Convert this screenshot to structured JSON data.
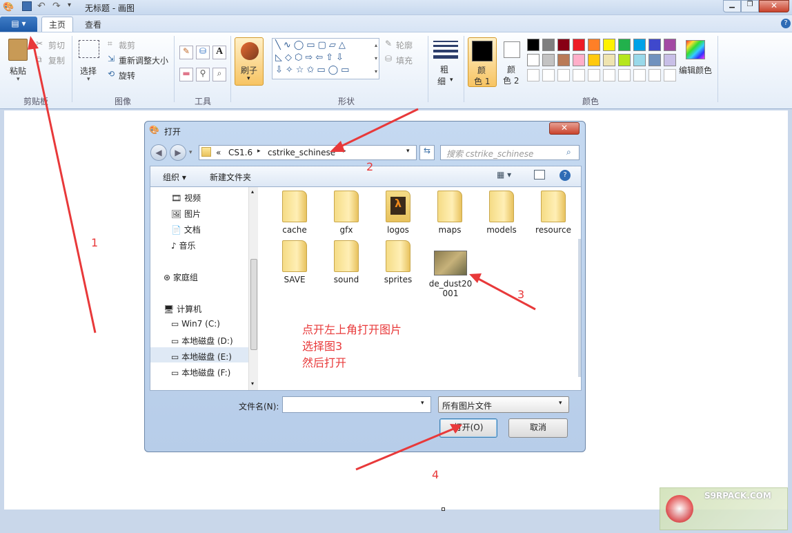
{
  "window": {
    "title": "无标题 - 画图"
  },
  "tabs": {
    "home": "主页",
    "view": "查看"
  },
  "ribbon": {
    "clipboard": {
      "paste": "粘贴",
      "cut": "剪切",
      "copy": "复制",
      "group": "剪贴板"
    },
    "image": {
      "select": "选择",
      "crop": "裁剪",
      "resize": "重新调整大小",
      "rotate": "旋转",
      "group": "图像"
    },
    "tools": {
      "group": "工具"
    },
    "brushes": {
      "label": "刷子"
    },
    "shapes": {
      "outline": "轮廓",
      "fill": "填充",
      "group": "形状"
    },
    "size": {
      "label1": "粗",
      "label2": "细"
    },
    "colors": {
      "color1_a": "颜",
      "color1_b": "色 1",
      "color2_a": "颜",
      "color2_b": "色 2",
      "edit": "编辑颜色",
      "group": "颜色",
      "palette_row1": [
        "#000000",
        "#7f7f7f",
        "#880015",
        "#ed1c24",
        "#ff7f27",
        "#fff200",
        "#22b14c",
        "#00a2e8",
        "#3f48cc",
        "#a349a4"
      ],
      "palette_row2": [
        "#ffffff",
        "#c3c3c3",
        "#b97a57",
        "#ffaec9",
        "#ffc90e",
        "#efe4b0",
        "#b5e61d",
        "#99d9ea",
        "#7092be",
        "#c8bfe7"
      ]
    }
  },
  "dialog": {
    "title": "打开",
    "breadcrumb": {
      "prefix": "«",
      "part1": "CS1.6",
      "part2": "cstrike_schinese"
    },
    "search_placeholder": "搜索 cstrike_schinese",
    "toolbar": {
      "organize": "组织 ▾",
      "new_folder": "新建文件夹"
    },
    "nav": {
      "videos": "视频",
      "pictures": "图片",
      "documents": "文档",
      "music": "音乐",
      "homegroup": "家庭组",
      "computer": "计算机",
      "c": "Win7 (C:)",
      "d": "本地磁盘 (D:)",
      "e": "本地磁盘 (E:)",
      "f": "本地磁盘 (F:)"
    },
    "files": [
      "cache",
      "gfx",
      "logos",
      "maps",
      "models",
      "resource",
      "SAVE",
      "sound",
      "sprites"
    ],
    "image_file": {
      "line1": "de_dust20",
      "line2": "001"
    },
    "filename_label": "文件名(N):",
    "filter": "所有图片文件",
    "open_button": "打开(O)",
    "cancel_button": "取消"
  },
  "annotations": {
    "n1": "1",
    "n2": "2",
    "n3": "3",
    "n4": "4",
    "line1": "点开左上角打开图片",
    "line2": "选择图3",
    "line3": "然后打开"
  },
  "watermark": "S9RPACK.COM"
}
